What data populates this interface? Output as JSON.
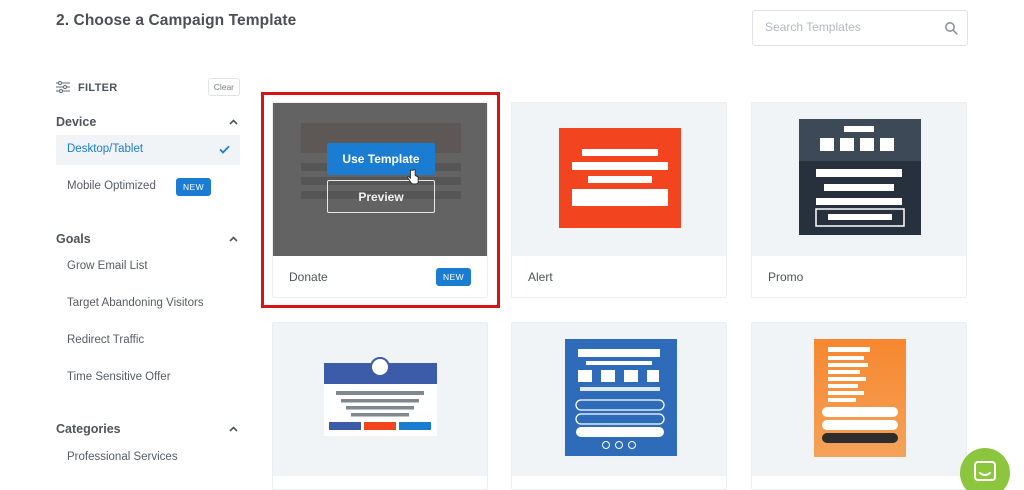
{
  "page": {
    "title": "2. Choose a Campaign Template"
  },
  "search": {
    "placeholder": "Search Templates",
    "icon": "search-icon"
  },
  "filter": {
    "label": "FILTER",
    "clear_label": "Clear"
  },
  "sections": {
    "device": {
      "label": "Device",
      "items": [
        {
          "label": "Desktop/Tablet",
          "active": true
        },
        {
          "label": "Mobile Optimized",
          "badge": "NEW"
        }
      ]
    },
    "goals": {
      "label": "Goals",
      "items": [
        {
          "label": "Grow Email List"
        },
        {
          "label": "Target Abandoning Visitors"
        },
        {
          "label": "Redirect Traffic"
        },
        {
          "label": "Time Sensitive Offer"
        }
      ]
    },
    "categories": {
      "label": "Categories",
      "items": [
        {
          "label": "Professional Services"
        }
      ]
    }
  },
  "templates": [
    {
      "name": "Donate",
      "badge": "NEW",
      "selected": true,
      "use_label": "Use Template",
      "preview_label": "Preview"
    },
    {
      "name": "Alert"
    },
    {
      "name": "Promo"
    },
    {
      "name": ""
    },
    {
      "name": ""
    },
    {
      "name": ""
    }
  ],
  "colors": {
    "accent": "#1a7dd1",
    "selection": "#d71414",
    "alert_red": "#f2451f",
    "promo_dark": "#26313d",
    "form_blue": "#2e6bb8",
    "orange": "#f7882f",
    "chat_green": "#8cc63f"
  }
}
